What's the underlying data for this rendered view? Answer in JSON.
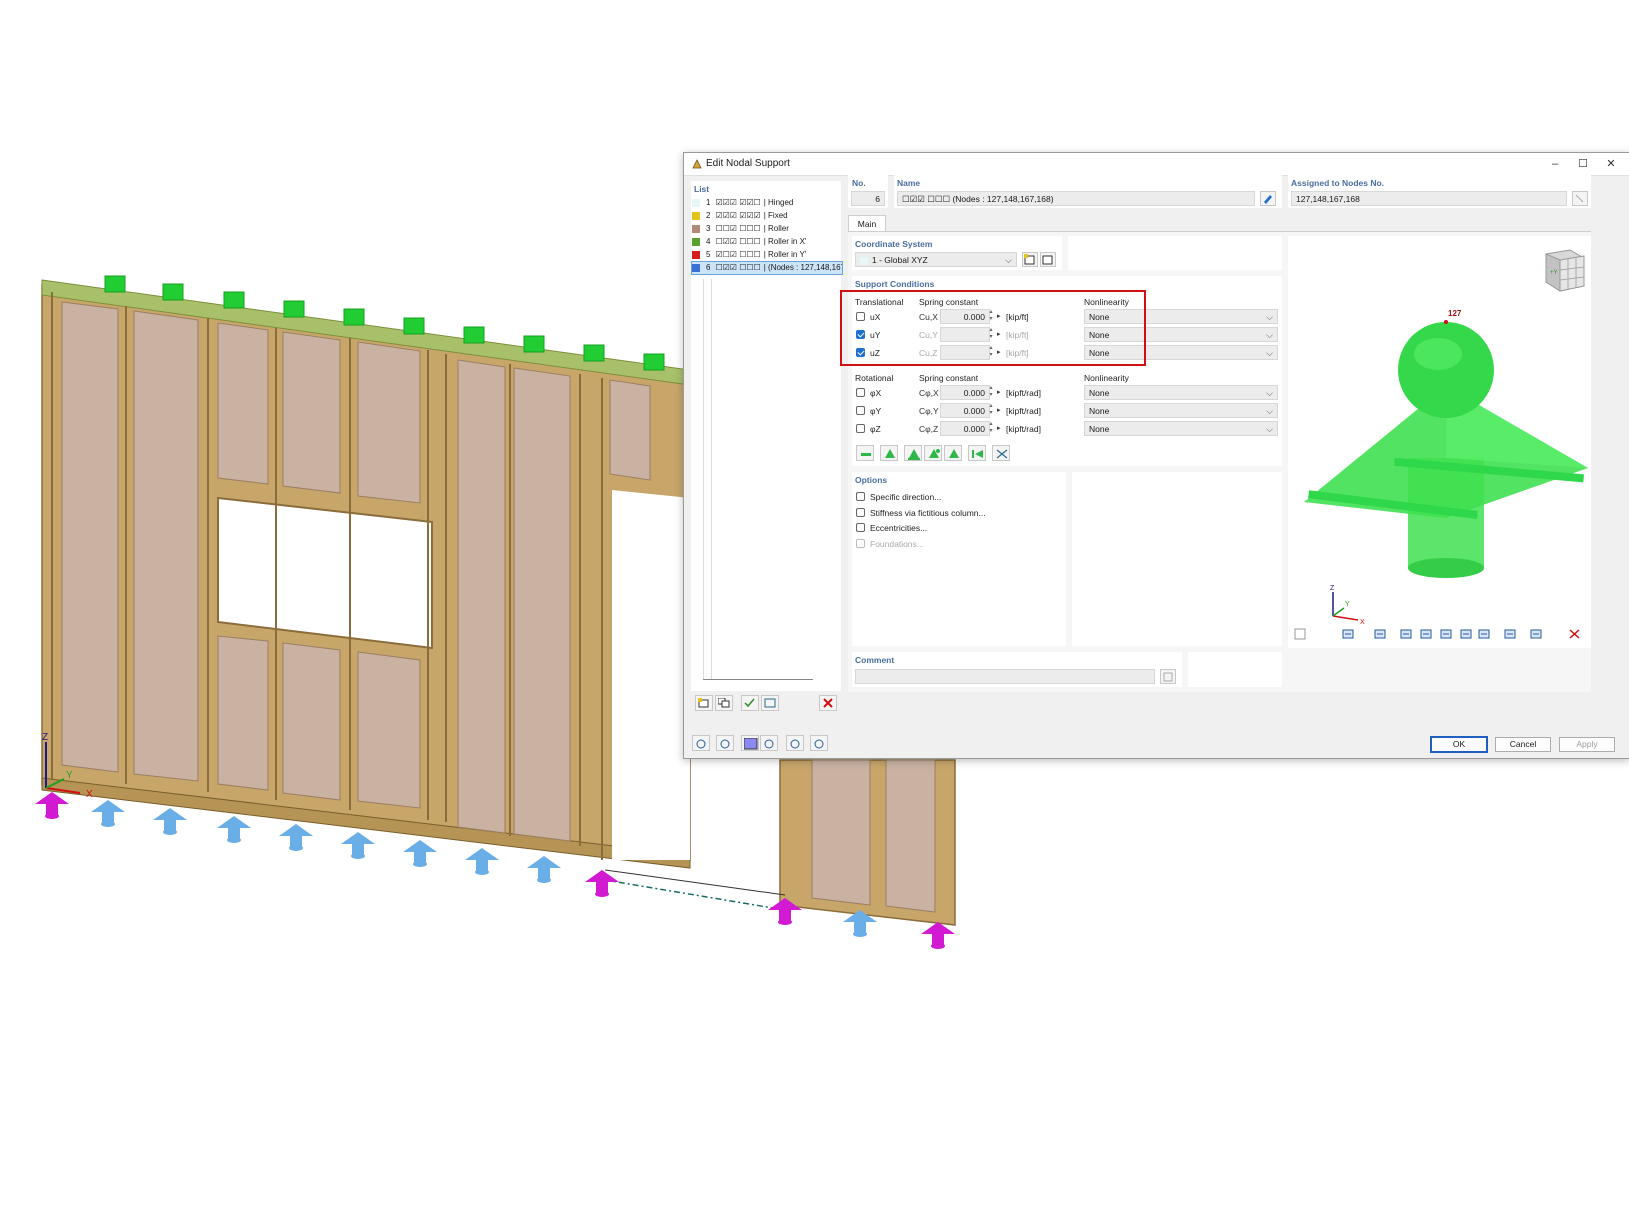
{
  "dialog": {
    "title": "Edit Nodal Support",
    "list_label": "List",
    "no_label": "No.",
    "no_value": "6",
    "name_label": "Name",
    "name_value": "☐☑☑ ☐☐☐ (Nodes : 127,148,167,168)",
    "assigned_label": "Assigned to Nodes No.",
    "assigned_value": "127,148,167,168",
    "tab_main": "Main",
    "coord_label": "Coordinate System",
    "coord_value": "1 - Global XYZ",
    "support_conditions_label": "Support Conditions",
    "options_label": "Options",
    "comment_label": "Comment",
    "comment_value": "",
    "ok": "OK",
    "cancel": "Cancel",
    "apply": "Apply"
  },
  "list_items": [
    {
      "no": "1",
      "codes": "☑☑☑ ☑☑☐",
      "name": "Hinged",
      "color": "#e6f7f5"
    },
    {
      "no": "2",
      "codes": "☑☑☑ ☑☑☑",
      "name": "Fixed",
      "color": "#e8c21c"
    },
    {
      "no": "3",
      "codes": "☐☐☑ ☐☐☐",
      "name": "Roller",
      "color": "#b08a78"
    },
    {
      "no": "4",
      "codes": "☐☑☑ ☐☐☐",
      "name": "Roller in X'",
      "color": "#5aa02c"
    },
    {
      "no": "5",
      "codes": "☑☐☑ ☐☐☐",
      "name": "Roller in Y'",
      "color": "#d81c1c"
    },
    {
      "no": "6",
      "codes": "☐☑☑ ☐☐☐",
      "name": "(Nodes : 127,148,167,168)",
      "color": "#3b6fd0"
    }
  ],
  "translational": {
    "header": "Translational",
    "spring_header": "Spring constant",
    "nonlinearity_header": "Nonlinearity",
    "rows": [
      {
        "dof": "uX",
        "spring_symbol": "Cu,X",
        "value": "0.000",
        "unit": "[kip/ft]",
        "checked": false,
        "nonlinearity": "None"
      },
      {
        "dof": "uY",
        "spring_symbol": "Cu,Y",
        "value": "",
        "unit": "[kip/ft]",
        "checked": true,
        "nonlinearity": "None"
      },
      {
        "dof": "uZ",
        "spring_symbol": "Cu,Z",
        "value": "",
        "unit": "[kip/ft]",
        "checked": true,
        "nonlinearity": "None"
      }
    ]
  },
  "rotational": {
    "header": "Rotational",
    "spring_header": "Spring constant",
    "nonlinearity_header": "Nonlinearity",
    "rows": [
      {
        "dof": "φX",
        "spring_symbol": "Cφ,X",
        "value": "0.000",
        "unit": "[kipft/rad]",
        "checked": false,
        "nonlinearity": "None"
      },
      {
        "dof": "φY",
        "spring_symbol": "Cφ,Y",
        "value": "0.000",
        "unit": "[kipft/rad]",
        "checked": false,
        "nonlinearity": "None"
      },
      {
        "dof": "φZ",
        "spring_symbol": "Cφ,Z",
        "value": "0.000",
        "unit": "[kipft/rad]",
        "checked": false,
        "nonlinearity": "None"
      }
    ]
  },
  "options": [
    {
      "label": "Specific direction...",
      "enabled": true
    },
    {
      "label": "Stiffness via fictitious column...",
      "enabled": true
    },
    {
      "label": "Eccentricities...",
      "enabled": true
    },
    {
      "label": "Foundations...",
      "enabled": false
    }
  ],
  "preview": {
    "node_label": "127",
    "axis_x": "X",
    "axis_y": "Y",
    "axis_z": "Z",
    "cube_label": "+Y",
    "support_color": "#2fd84a"
  },
  "scene": {
    "axis_x": "X",
    "axis_y": "Y",
    "axis_z": "Z",
    "wall_color": "#c8a66a",
    "panel_color": "#c7ad9b",
    "blue_support": "#6aaee8",
    "magenta_support": "#d21ad2",
    "green_support": "#22cc33"
  }
}
